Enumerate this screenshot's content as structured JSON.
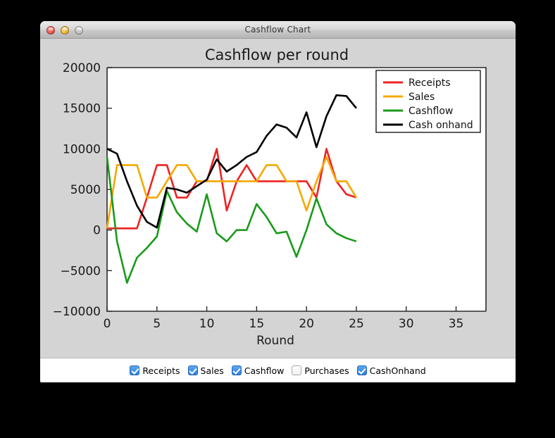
{
  "window": {
    "title": "Cashflow Chart",
    "controls": [
      {
        "name": "close-button",
        "color": "#e8554a"
      },
      {
        "name": "minimize-button",
        "color": "#eeb32e"
      },
      {
        "name": "zoom-button",
        "color": "#73c13f"
      }
    ]
  },
  "controlbar": {
    "items": [
      {
        "label": "Receipts",
        "checked": true
      },
      {
        "label": "Sales",
        "checked": true
      },
      {
        "label": "Cashflow",
        "checked": true
      },
      {
        "label": "Purchases",
        "checked": false
      },
      {
        "label": "CashOnhand",
        "checked": true
      }
    ]
  },
  "chart_data": {
    "type": "line",
    "title": "Cashflow per round",
    "xlabel": "Round",
    "ylabel": "",
    "xlim": [
      0,
      38
    ],
    "ylim": [
      -10000,
      20000
    ],
    "xticks": [
      0,
      5,
      10,
      15,
      20,
      25,
      30,
      35
    ],
    "yticks": [
      -10000,
      -5000,
      0,
      5000,
      10000,
      15000,
      20000
    ],
    "xticklabels": [
      "0",
      "5",
      "10",
      "15",
      "20",
      "25",
      "30",
      "35"
    ],
    "yticklabels": [
      "−10000",
      "−5000",
      "0",
      "5000",
      "10000",
      "15000",
      "20000"
    ],
    "grid": false,
    "legend_position": "upper right",
    "x": [
      0,
      1,
      2,
      3,
      4,
      5,
      6,
      7,
      8,
      9,
      10,
      11,
      12,
      13,
      14,
      15,
      16,
      17,
      18,
      19,
      20,
      21,
      22,
      23,
      24,
      25
    ],
    "series": [
      {
        "name": "Receipts",
        "color": "#ee2222",
        "values": [
          200,
          200,
          200,
          200,
          4000,
          8000,
          8000,
          4000,
          4000,
          6000,
          6000,
          10000,
          2400,
          6000,
          8000,
          6000,
          6000,
          6000,
          6000,
          6000,
          6000,
          4000,
          10000,
          6000,
          4400,
          4000
        ]
      },
      {
        "name": "Sales",
        "color": "#f5a800",
        "values": [
          200,
          8000,
          8000,
          8000,
          4000,
          4000,
          6000,
          8000,
          8000,
          6000,
          6000,
          6000,
          6000,
          6000,
          6000,
          6000,
          8000,
          8000,
          6000,
          6000,
          2400,
          6000,
          9000,
          6000,
          6000,
          4000
        ]
      },
      {
        "name": "Cashflow",
        "color": "#1a9a1a",
        "values": [
          9000,
          -1400,
          -6500,
          -3400,
          -2200,
          -800,
          4800,
          2200,
          800,
          -200,
          4400,
          -400,
          -1400,
          0,
          0,
          3200,
          1600,
          -400,
          -200,
          -3300,
          0,
          3900,
          700,
          -400,
          -1000,
          -1400
        ]
      },
      {
        "name": "Cash onhand",
        "color": "#000000",
        "values": [
          10000,
          9400,
          6000,
          3000,
          1000,
          300,
          5200,
          5000,
          4600,
          5400,
          6200,
          8700,
          7200,
          8000,
          9000,
          9600,
          11600,
          13000,
          12600,
          11400,
          14500,
          10200,
          14000,
          16600,
          16500,
          15000
        ]
      }
    ],
    "legend_entries": [
      "Receipts",
      "Sales",
      "Cashflow",
      "Cash onhand"
    ]
  }
}
